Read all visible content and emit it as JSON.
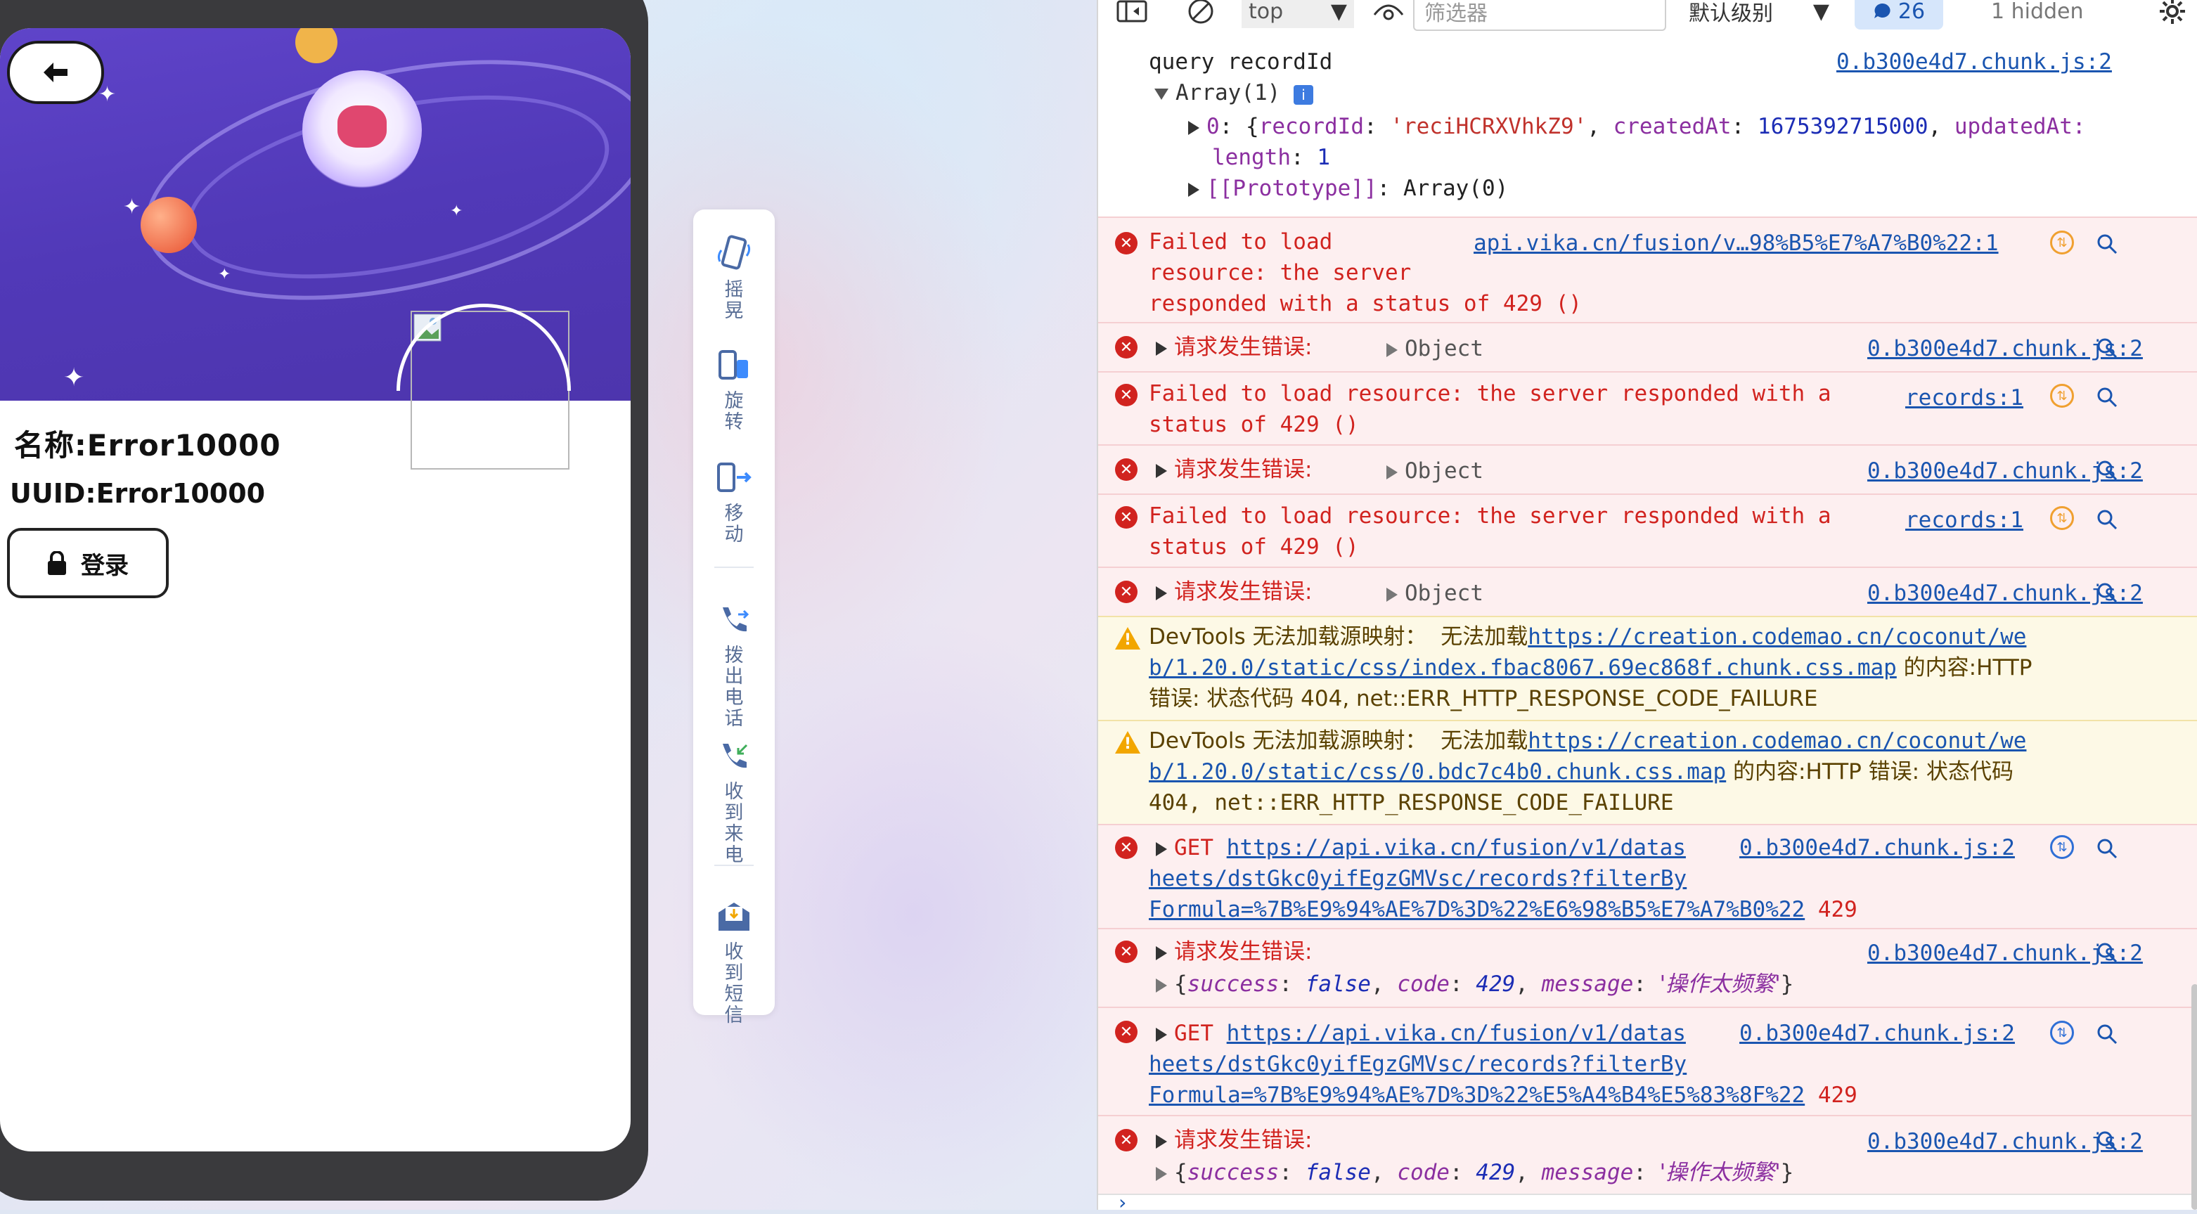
{
  "phone": {
    "name_label": "名称:Error10000",
    "uuid_label": "UUID:Error10000",
    "login_label": "登录"
  },
  "tools": [
    {
      "label": "摇晃",
      "icon": "shake-phone-icon"
    },
    {
      "label": "旋转",
      "icon": "rotate-phone-icon"
    },
    {
      "label": "移动",
      "icon": "move-phone-icon"
    },
    {
      "label": "拨出电话",
      "icon": "outgoing-call-icon"
    },
    {
      "label": "收到来电",
      "icon": "incoming-call-icon"
    },
    {
      "label": "收到短信",
      "icon": "incoming-sms-icon"
    }
  ],
  "devtools": {
    "context": "top",
    "filter_placeholder": "筛选器",
    "level": "默认级别",
    "issues_count": "26",
    "hidden": "1 hidden"
  },
  "console": {
    "query_text": "query recordId",
    "query_src": "0.b300e4d7.chunk.js:2",
    "array_label": "Array(1)",
    "item0_prefix": "0",
    "item0_record_key": "recordId",
    "item0_record_val": "'reciHCRXVhkZ9'",
    "item0_created_key": "createdAt",
    "item0_created_val": "1675392715000",
    "item0_updated_key": "updatedAt:",
    "length_key": "length",
    "length_val": "1",
    "proto_text": "[[Prototype]]",
    "proto_val": "Array(0)",
    "err1_line1": "Failed to load",
    "err1_line2": "resource: the server",
    "err1_line3": "responded with a status of 429 ()",
    "err1_src": "api.vika.cn/fusion/v…98%B5%E7%A7%B0%22:1",
    "req_err_label": "请求发生错误:",
    "object_label": "Object",
    "chunk_src": "0.b300e4d7.chunk.js:2",
    "fail_line1": "Failed to load resource: the server responded with a",
    "fail_line2": "status of 429 ()",
    "records_src": "records:1",
    "warn1_prefix": "DevTools 无法加载源映射：  无法加载",
    "warn1_link1": "https://creation.codemao.cn/coconut/we",
    "warn1_link2": "b/1.20.0/static/css/index.fbac8067.69ec868f.chunk.css.map",
    "warn1_tail": " 的内容:HTTP",
    "warn1_line3": "错误: 状态代码 404, net::ERR_HTTP_RESPONSE_CODE_FAILURE",
    "warn2_link1": "https://creation.codemao.cn/coconut/we",
    "warn2_link2": "b/1.20.0/static/css/0.bdc7c4b0.chunk.css.map",
    "warn2_tail": " 的内容:HTTP 错误: 状态代码",
    "warn2_line3": "404, net::ERR_HTTP_RESPONSE_CODE_FAILURE",
    "get_label": "GET",
    "get1_l1": "https://api.vika.cn/fusion/v1/datas",
    "get1_l2": "heets/dstGkc0yifEgzGMVsc/records?filterBy",
    "get1_l3": "Formula=%7B%E9%94%AE%7D%3D%22%E6%98%B5%E7%A7%B0%22",
    "get_status": "429",
    "get2_l3": "Formula=%7B%E9%94%AE%7D%3D%22%E5%A4%B4%E5%83%8F%22",
    "resp_success_key": "success",
    "resp_success_val": "false",
    "resp_code_key": "code",
    "resp_code_val": "429",
    "resp_msg_key": "message",
    "resp_msg_val": "'操作太频繁'"
  },
  "colors": {
    "error_red": "#d1231f",
    "link_blue": "#1a55b0",
    "warn_yellow": "#f2a600",
    "hero_purple": "#5139b8"
  }
}
